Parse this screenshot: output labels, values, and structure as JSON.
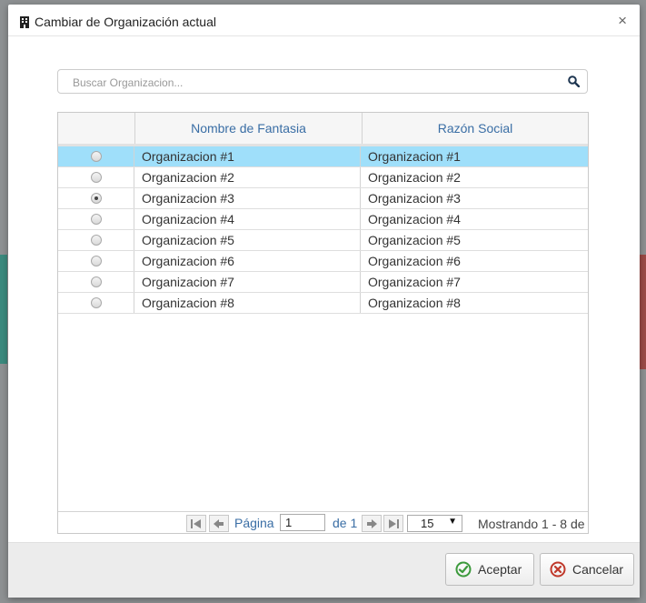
{
  "dialog": {
    "title": "Cambiar de Organización actual",
    "close_label": "×"
  },
  "search": {
    "placeholder": "Buscar Organizacion...",
    "value": ""
  },
  "table": {
    "columns": [
      "",
      "Nombre de Fantasia",
      "Razón Social"
    ],
    "rows": [
      {
        "nombre": "Organizacion #1",
        "razon": "Organizacion #1",
        "highlighted": true,
        "checked": false
      },
      {
        "nombre": "Organizacion #2",
        "razon": "Organizacion #2",
        "highlighted": false,
        "checked": false
      },
      {
        "nombre": "Organizacion #3",
        "razon": "Organizacion #3",
        "highlighted": false,
        "checked": true
      },
      {
        "nombre": "Organizacion #4",
        "razon": "Organizacion #4",
        "highlighted": false,
        "checked": false
      },
      {
        "nombre": "Organizacion #5",
        "razon": "Organizacion #5",
        "highlighted": false,
        "checked": false
      },
      {
        "nombre": "Organizacion #6",
        "razon": "Organizacion #6",
        "highlighted": false,
        "checked": false
      },
      {
        "nombre": "Organizacion #7",
        "razon": "Organizacion #7",
        "highlighted": false,
        "checked": false
      },
      {
        "nombre": "Organizacion #8",
        "razon": "Organizacion #8",
        "highlighted": false,
        "checked": false
      }
    ]
  },
  "pager": {
    "page_label": "Página",
    "page_value": "1",
    "of_label": "de 1",
    "page_size": "15",
    "showing": "Mostrando 1 - 8 de"
  },
  "footer": {
    "accept_label": "Aceptar",
    "cancel_label": "Cancelar"
  },
  "colors": {
    "row_highlight": "#9fdffa",
    "header_text": "#3a6ea5",
    "accept_icon": "#3c9a3c",
    "cancel_icon": "#c0392b"
  }
}
